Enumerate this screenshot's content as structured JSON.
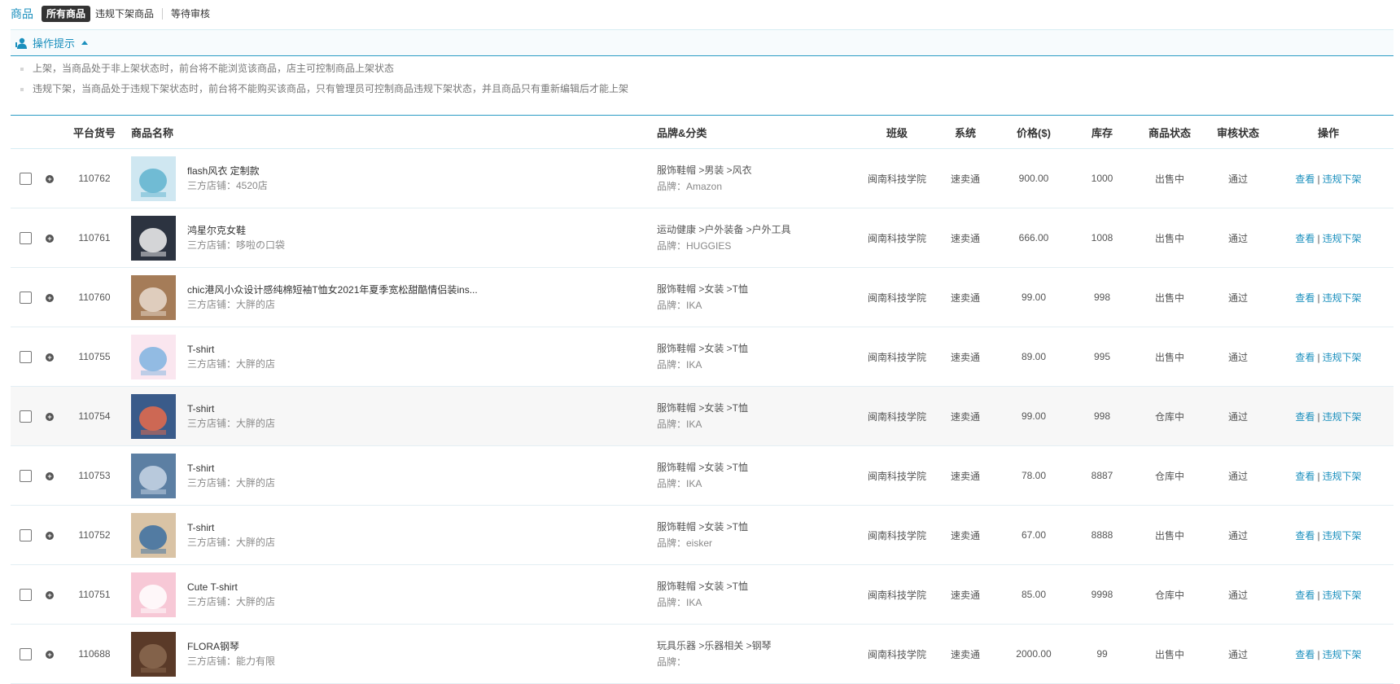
{
  "header": {
    "title": "商品",
    "tabs": [
      {
        "label": "所有商品",
        "active": true
      },
      {
        "label": "违规下架商品",
        "active": false
      },
      {
        "label": "等待审核",
        "active": false
      }
    ]
  },
  "tips": {
    "title": "操作提示",
    "items": [
      "上架，当商品处于非上架状态时，前台将不能浏览该商品，店主可控制商品上架状态",
      "违规下架，当商品处于违规下架状态时，前台将不能购买该商品，只有管理员可控制商品违规下架状态，并且商品只有重新编辑后才能上架"
    ]
  },
  "table": {
    "headers": {
      "id": "平台货号",
      "name": "商品名称",
      "brand": "品牌&分类",
      "class": "班级",
      "system": "系统",
      "price": "价格($)",
      "stock": "库存",
      "status": "商品状态",
      "audit": "审核状态",
      "ops": "操作"
    },
    "actions": {
      "view": "查看",
      "separator": "|",
      "takedown": "违规下架"
    },
    "rows": [
      {
        "id": "110762",
        "name": "flash风衣 定制款",
        "shop": "三方店铺：4520店",
        "category": "服饰鞋帽 >男装 >风衣",
        "brand": "品牌：Amazon",
        "class": "闽南科技学院",
        "system": "速卖通",
        "price": "900.00",
        "stock": "1000",
        "status": "出售中",
        "audit": "通过"
      },
      {
        "id": "110761",
        "name": "鸿星尔克女鞋",
        "shop": "三方店铺：哆啦の口袋",
        "category": "运动健康 >户外装备 >户外工具",
        "brand": "品牌：HUGGIES",
        "class": "闽南科技学院",
        "system": "速卖通",
        "price": "666.00",
        "stock": "1008",
        "status": "出售中",
        "audit": "通过"
      },
      {
        "id": "110760",
        "name": "chic港风小众设计感纯棉短袖T恤女2021年夏季宽松甜酷情侣装ins...",
        "shop": "三方店铺：大胖的店",
        "category": "服饰鞋帽 >女装 >T恤",
        "brand": "品牌：IKA",
        "class": "闽南科技学院",
        "system": "速卖通",
        "price": "99.00",
        "stock": "998",
        "status": "出售中",
        "audit": "通过"
      },
      {
        "id": "110755",
        "name": "T-shirt",
        "shop": "三方店铺：大胖的店",
        "category": "服饰鞋帽 >女装 >T恤",
        "brand": "品牌：IKA",
        "class": "闽南科技学院",
        "system": "速卖通",
        "price": "89.00",
        "stock": "995",
        "status": "出售中",
        "audit": "通过"
      },
      {
        "id": "110754",
        "name": "T-shirt",
        "shop": "三方店铺：大胖的店",
        "category": "服饰鞋帽 >女装 >T恤",
        "brand": "品牌：IKA",
        "class": "闽南科技学院",
        "system": "速卖通",
        "price": "99.00",
        "stock": "998",
        "status": "仓库中",
        "audit": "通过"
      },
      {
        "id": "110753",
        "name": "T-shirt",
        "shop": "三方店铺：大胖的店",
        "category": "服饰鞋帽 >女装 >T恤",
        "brand": "品牌：IKA",
        "class": "闽南科技学院",
        "system": "速卖通",
        "price": "78.00",
        "stock": "8887",
        "status": "仓库中",
        "audit": "通过"
      },
      {
        "id": "110752",
        "name": "T-shirt",
        "shop": "三方店铺：大胖的店",
        "category": "服饰鞋帽 >女装 >T恤",
        "brand": "品牌：eisker",
        "class": "闽南科技学院",
        "system": "速卖通",
        "price": "67.00",
        "stock": "8888",
        "status": "出售中",
        "audit": "通过"
      },
      {
        "id": "110751",
        "name": "Cute T-shirt",
        "shop": "三方店铺：大胖的店",
        "category": "服饰鞋帽 >女装 >T恤",
        "brand": "品牌：IKA",
        "class": "闽南科技学院",
        "system": "速卖通",
        "price": "85.00",
        "stock": "9998",
        "status": "仓库中",
        "audit": "通过"
      },
      {
        "id": "110688",
        "name": "FLORA钢琴",
        "shop": "三方店铺：能力有限",
        "category": "玩具乐器 >乐器相关 >钢琴",
        "brand": "品牌：",
        "class": "闽南科技学院",
        "system": "速卖通",
        "price": "2000.00",
        "stock": "99",
        "status": "出售中",
        "audit": "通过"
      }
    ]
  },
  "colors": {
    "accent": "#1a8fbd",
    "active_tab": "#333333",
    "row_highlight": "#f7f7f7"
  }
}
